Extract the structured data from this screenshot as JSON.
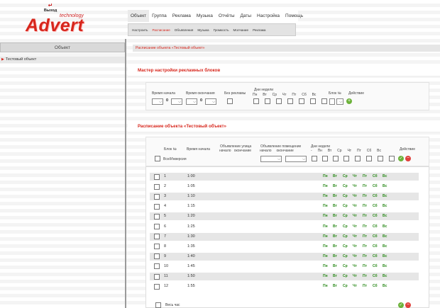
{
  "header": {
    "logout": "Выход",
    "logo_main": "Advert",
    "logo_sub": "technology",
    "menu": [
      "Объект",
      "Группа",
      "Реклама",
      "Музыка",
      "Отчёты",
      "Даты",
      "Настройка",
      "Помощь"
    ],
    "submenu": [
      "Настроить",
      "Расписание",
      "Объявления",
      "Музыка",
      "Громкость",
      "Молчание",
      "Реклама"
    ]
  },
  "sidebar": {
    "title": "Объект",
    "items": [
      "Тестовый объект"
    ]
  },
  "breadcrumb": "Расписание объекта «Тестовый объект»",
  "wizard": {
    "title": "Мастер настройки рекламных блоков",
    "labels": {
      "start": "Время начала",
      "end": "Время окончания",
      "no_ads": "Без рекламы",
      "weekdays": "Дни недели",
      "block": "Блок №",
      "action": "Действие"
    },
    "start_value": "0",
    "end_value": "0",
    "days": [
      "Пн",
      "Вт",
      "Ср",
      "Чт",
      "Пт",
      "Сб",
      "Вс"
    ]
  },
  "schedule": {
    "title": "Расписание объекта «Тестовый объект»",
    "headers": {
      "block": "Блок №",
      "start": "Время начала",
      "street_ann": "Объявление улица",
      "street_sub": "начало   окончание",
      "room_ann": "Объявление помещение",
      "room_sub": "начало     окончание",
      "weekdays": "Дни недели",
      "action": "Действие"
    },
    "days": [
      "Пн",
      "Вт",
      "Ср",
      "Чт",
      "Пт",
      "Сб",
      "Вс"
    ],
    "all_label": "Все/Инверсия",
    "rows": [
      {
        "n": "1",
        "t": "1:00"
      },
      {
        "n": "2",
        "t": "1:05"
      },
      {
        "n": "3",
        "t": "1:10"
      },
      {
        "n": "4",
        "t": "1:15"
      },
      {
        "n": "5",
        "t": "1:20"
      },
      {
        "n": "6",
        "t": "1:25"
      },
      {
        "n": "7",
        "t": "1:30"
      },
      {
        "n": "8",
        "t": "1:35"
      },
      {
        "n": "9",
        "t": "1:40"
      },
      {
        "n": "10",
        "t": "1:45"
      },
      {
        "n": "11",
        "t": "1:50"
      },
      {
        "n": "12",
        "t": "1:55"
      }
    ],
    "whole_hour": "Весь час"
  }
}
